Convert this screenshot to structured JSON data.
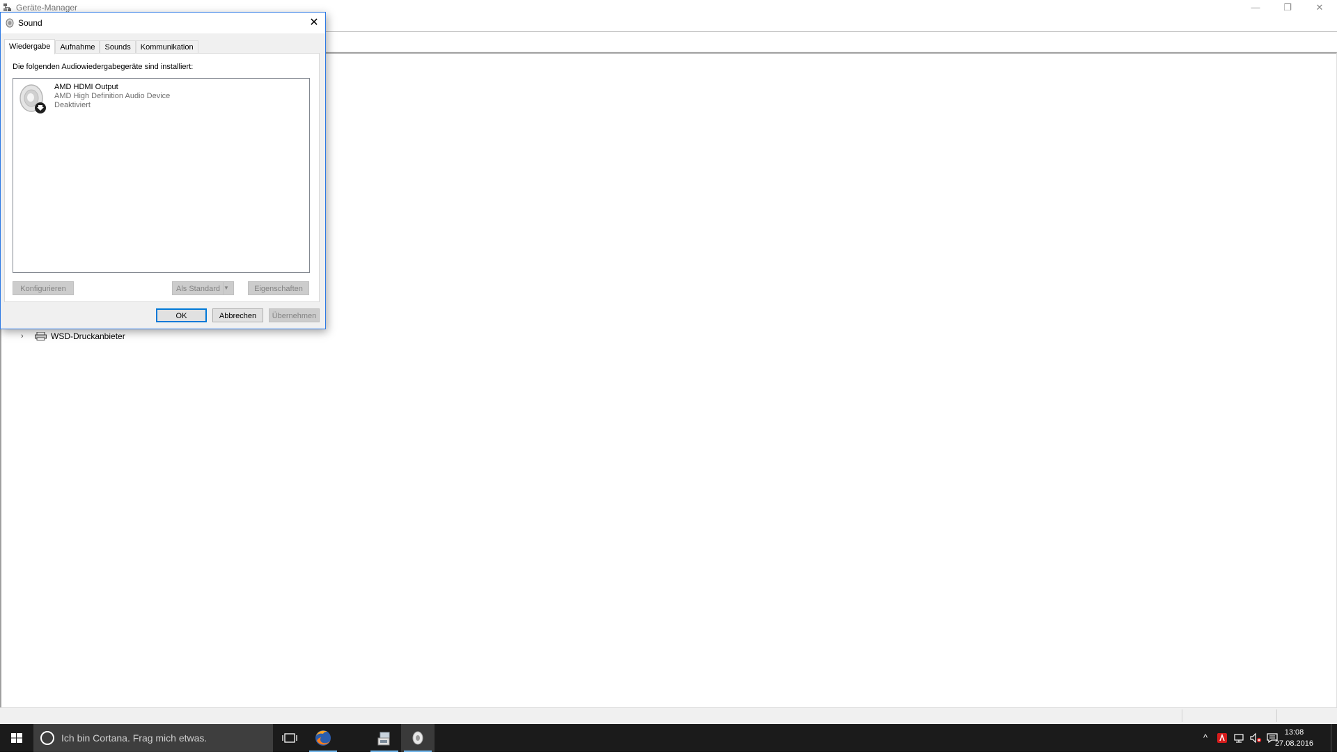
{
  "background_window": {
    "title": "Geräte-Manager",
    "controls": {
      "minimize": "—",
      "restore": "❐",
      "close": "✕"
    },
    "tree_row": {
      "chevron": "›",
      "label": "WSD-Druckanbieter"
    }
  },
  "dialog": {
    "title": "Sound",
    "close_glyph": "✕",
    "tabs": [
      {
        "label": "Wiedergabe",
        "active": true
      },
      {
        "label": "Aufnahme",
        "active": false
      },
      {
        "label": "Sounds",
        "active": false
      },
      {
        "label": "Kommunikation",
        "active": false
      }
    ],
    "panel_label": "Die folgenden Audiowiedergabegeräte sind installiert:",
    "devices": [
      {
        "name": "AMD HDMI Output",
        "driver": "AMD High Definition Audio Device",
        "status": "Deaktiviert",
        "icon": "speaker-disabled-icon"
      }
    ],
    "panel_buttons": {
      "configure": "Konfigurieren",
      "set_default": "Als Standard",
      "set_default_arrow": "▼",
      "properties": "Eigenschaften"
    },
    "footer_buttons": {
      "ok": "OK",
      "cancel": "Abbrechen",
      "apply": "Übernehmen"
    }
  },
  "taskbar": {
    "search_placeholder": "Ich bin Cortana. Frag mich etwas.",
    "apps": [
      {
        "name": "task-view",
        "icon": "task-view-icon"
      },
      {
        "name": "firefox",
        "icon": "firefox-icon",
        "open": true
      },
      {
        "name": "device-manager",
        "icon": "device-manager-icon",
        "open": true
      },
      {
        "name": "sound",
        "icon": "sound-icon",
        "open": true,
        "active": true
      }
    ],
    "tray": {
      "chevron": "^",
      "time": "13:08",
      "date": "27.08.2016"
    }
  },
  "colors": {
    "taskbar_bg": "#1b1b1b",
    "search_bg": "#3e3e3e",
    "accent": "#0078d7",
    "dialog_bg": "#f0f0f0",
    "taskbar_underline": "#76b9ed"
  }
}
